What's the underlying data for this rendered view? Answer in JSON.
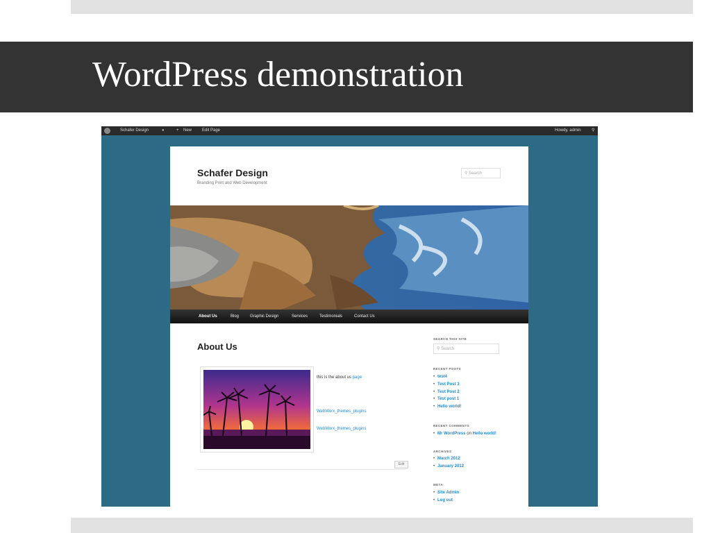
{
  "slide": {
    "title": "WordPress demonstration"
  },
  "adminbar": {
    "site_name": "Schafer Design",
    "new_label": "New",
    "edit_label": "Edit Page",
    "howdy": "Howdy, admin"
  },
  "site": {
    "title": "Schafer Design",
    "description": "Branding Print and Web Development",
    "search_placeholder": "Search"
  },
  "nav": {
    "items": [
      "About Us",
      "Blog",
      "Graphic Design",
      "Services",
      "Testimonials",
      "Contact Us"
    ]
  },
  "main": {
    "title": "About Us",
    "text_prefix": "this is the about us ",
    "text_link": "page",
    "links": [
      "WebWorx_themes_plugins",
      "WebWorx_themes_plugins"
    ],
    "edit_label": "Edit"
  },
  "sidebar": {
    "search_heading": "SEARCH THIS SITE",
    "search_placeholder": "Search",
    "recent_posts_heading": "RECENT POSTS",
    "recent_posts": [
      "test4",
      "Test Post 3",
      "Test Post 2",
      "Test post 1",
      "Hello world!"
    ],
    "recent_comments_heading": "RECENT COMMENTS",
    "comment_author": "Mr WordPress",
    "comment_on": " on ",
    "comment_post": "Hello world!",
    "archives_heading": "ARCHIVES",
    "archives": [
      "March 2012",
      "January 2012"
    ],
    "meta_heading": "META",
    "meta": [
      "Site Admin",
      "Log out"
    ]
  },
  "colors": {
    "title_band": "#333333",
    "page_background": "#2d6a85",
    "link": "#1b8be0"
  }
}
